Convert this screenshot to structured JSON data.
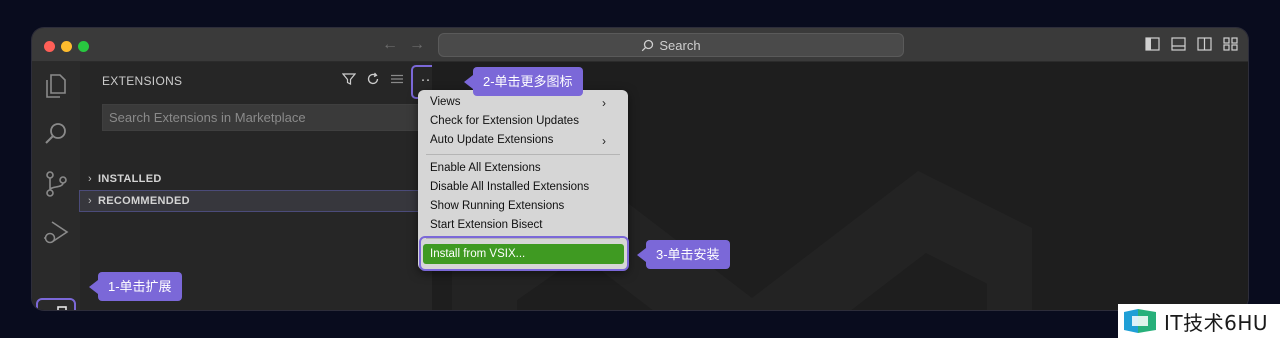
{
  "titlebar": {
    "search_label": "Search",
    "traffic_lights": [
      "#ff5f57",
      "#febc2e",
      "#28c840"
    ]
  },
  "activity_bar": {
    "items": [
      "explorer-icon",
      "search-icon",
      "source-control-icon",
      "run-debug-icon",
      "extensions-icon"
    ]
  },
  "sidebar": {
    "title": "EXTENSIONS",
    "more_label": "···",
    "search_placeholder": "Search Extensions in Marketplace",
    "sections": [
      {
        "label": "INSTALLED"
      },
      {
        "label": "RECOMMENDED"
      }
    ]
  },
  "menu": {
    "items": [
      {
        "label": "Views",
        "submenu": true
      },
      {
        "label": "Check for Extension Updates",
        "submenu": false
      },
      {
        "label": "Auto Update Extensions",
        "submenu": true
      },
      {
        "label": "Enable All Extensions",
        "submenu": false
      },
      {
        "label": "Disable All Installed Extensions",
        "submenu": false
      },
      {
        "label": "Show Running Extensions",
        "submenu": false
      },
      {
        "label": "Start Extension Bisect",
        "submenu": false
      },
      {
        "label": "Install from VSIX...",
        "submenu": false,
        "highlighted": true
      }
    ]
  },
  "callouts": {
    "step1": "1-单击扩展",
    "step2": "2-单击更多图标",
    "step3": "3-单击安装"
  },
  "watermark": {
    "text": "IT技术6HU"
  },
  "colors": {
    "accent": "#7b68d8",
    "highlight_green": "#3f9a22"
  }
}
